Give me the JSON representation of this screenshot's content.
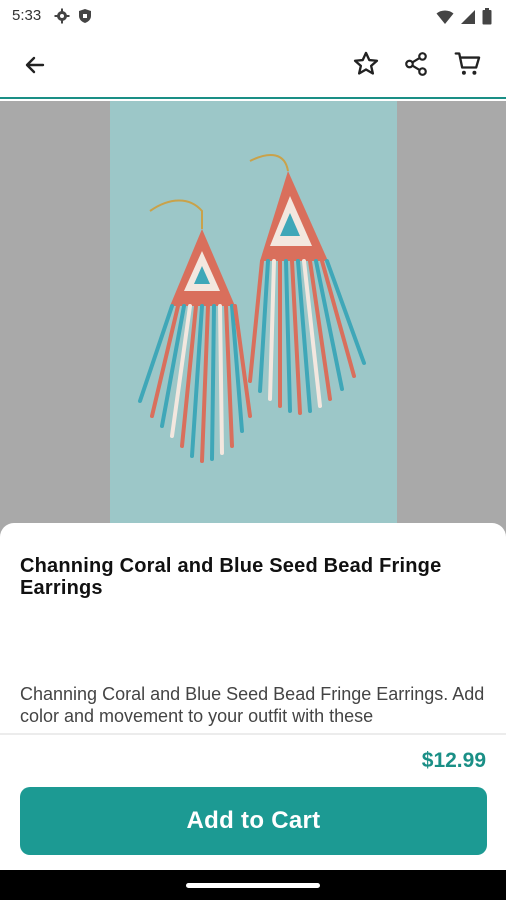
{
  "status_bar": {
    "time": "5:33",
    "left_icons": [
      "settings-gear-icon",
      "shield-icon"
    ],
    "right_icons": [
      "wifi-icon",
      "cell-signal-icon",
      "battery-icon"
    ]
  },
  "app_bar": {
    "back_icon": "arrow-left-icon",
    "actions": [
      "star-icon",
      "share-icon",
      "cart-icon"
    ],
    "accent_color": "#1a8f86"
  },
  "product": {
    "image_desc": "coral-and-blue-seed-bead-fringe-earrings",
    "title": "Channing Coral and Blue Seed Bead Fringe Earrings",
    "description": "Channing Coral and Blue Seed Bead Fringe Earrings. Add color and movement to your outfit with these",
    "price": "$12.99"
  },
  "actions": {
    "add_to_cart_label": "Add to Cart",
    "button_color": "#1c9a93"
  }
}
